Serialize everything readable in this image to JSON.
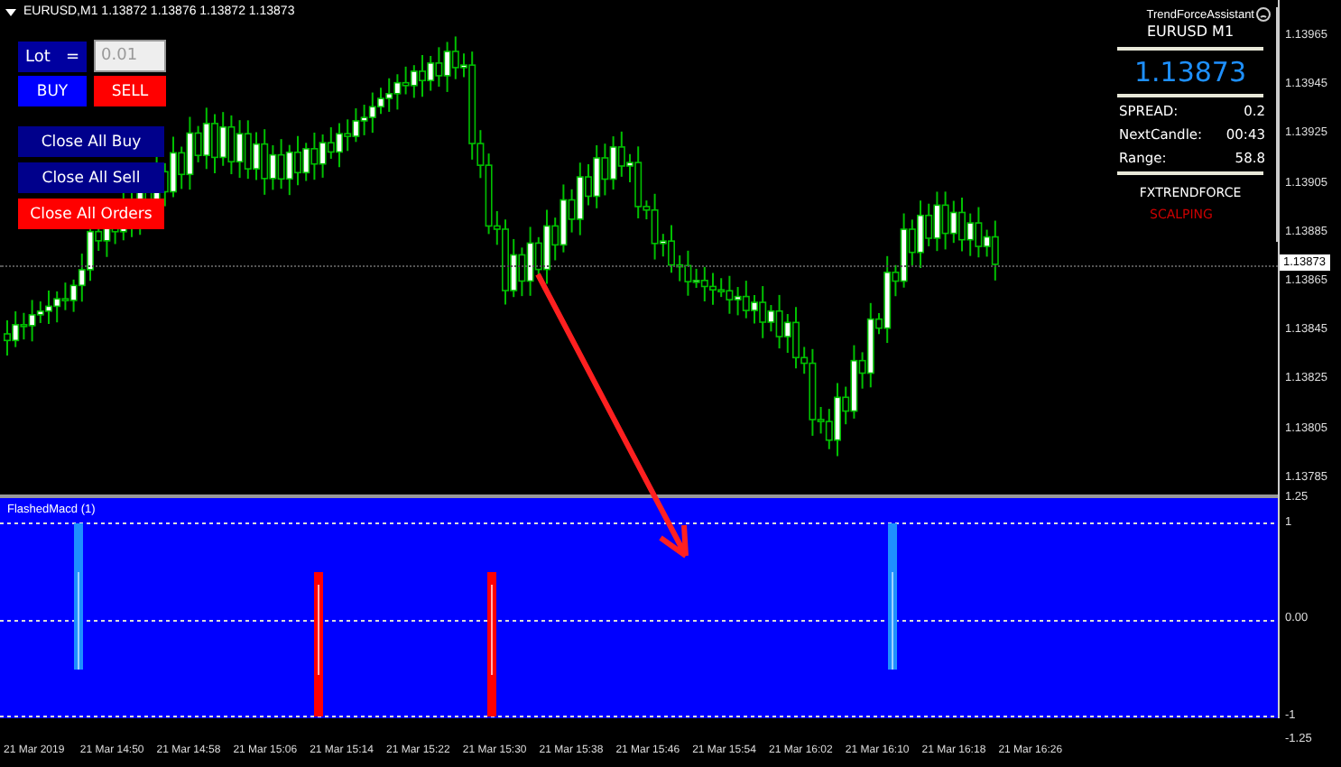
{
  "chart": {
    "title": "EURUSD,M1 1.13872 1.13876 1.13872 1.13873",
    "current_price": "1.13873",
    "price_axis": [
      "1.13965",
      "1.13945",
      "1.13925",
      "1.13905",
      "1.13885",
      "1.13865",
      "1.13845",
      "1.13825",
      "1.13805",
      "1.13785"
    ]
  },
  "trade_panel": {
    "lot_label": "Lot   =",
    "lot_value": "0.01",
    "buttons": [
      {
        "label": "BUY",
        "kind": "buy"
      },
      {
        "label": "SELL",
        "kind": "sell"
      },
      {
        "label": "Close All Buy",
        "kind": "close"
      },
      {
        "label": "Close All Sell",
        "kind": "close"
      },
      {
        "label": "Close All Orders",
        "kind": "close-all"
      }
    ]
  },
  "assistant": {
    "title": "TrendForceAssistant",
    "symbol": "EURUSD  M1",
    "price": "1.13873",
    "stats": [
      {
        "label": "SPREAD:",
        "value": "0.2"
      },
      {
        "label": "NextCandle:",
        "value": "00:43"
      },
      {
        "label": "Range:",
        "value": "58.8"
      }
    ],
    "brand": "FXTRENDFORCE",
    "tagline": "SCALPING"
  },
  "indicator": {
    "title": "FlashedMacd (1)",
    "axis": [
      "1.25",
      "1",
      "0.00",
      "-1",
      "-1.25"
    ]
  },
  "time_axis": [
    "21 Mar 2019",
    "21 Mar 14:50",
    "21 Mar 14:58",
    "21 Mar 15:06",
    "21 Mar 15:14",
    "21 Mar 15:22",
    "21 Mar 15:30",
    "21 Mar 15:38",
    "21 Mar 15:46",
    "21 Mar 15:54",
    "21 Mar 16:02",
    "21 Mar 16:10",
    "21 Mar 16:18",
    "21 Mar 16:26"
  ]
}
